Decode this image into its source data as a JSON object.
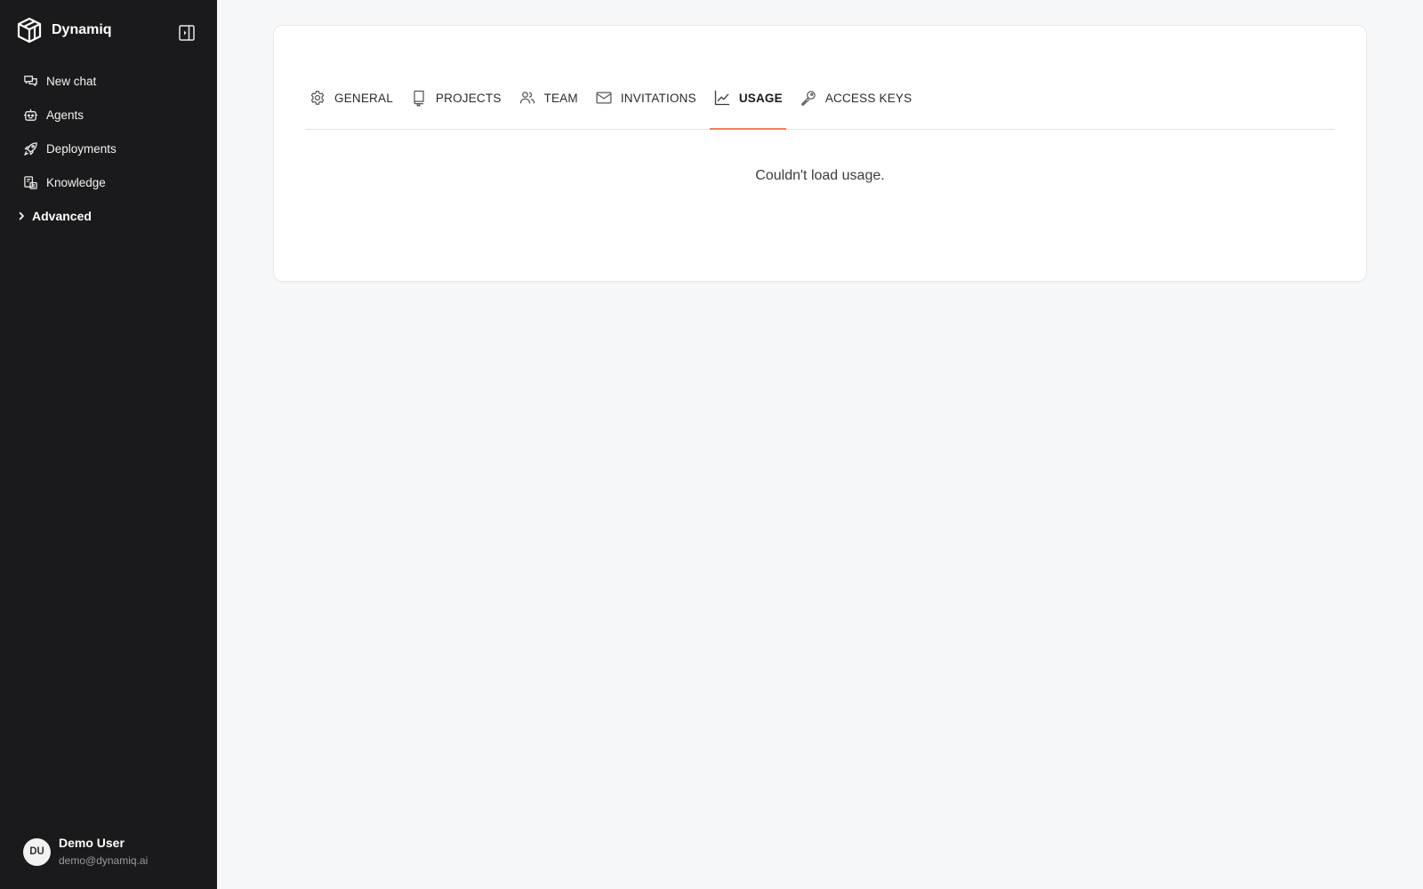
{
  "brand": {
    "name": "Dynamiq"
  },
  "sidebar": {
    "items": [
      {
        "label": "New chat",
        "icon": "chat-icon"
      },
      {
        "label": "Agents",
        "icon": "robot-icon"
      },
      {
        "label": "Deployments",
        "icon": "rocket-icon"
      },
      {
        "label": "Knowledge",
        "icon": "knowledge-icon"
      }
    ],
    "group": {
      "label": "Advanced",
      "icon": "chevron-right-icon"
    }
  },
  "user": {
    "initials": "DU",
    "name": "Demo User",
    "email": "demo@dynamiq.ai"
  },
  "settings": {
    "tabs": [
      {
        "label": "GENERAL",
        "icon": "gear-icon"
      },
      {
        "label": "PROJECTS",
        "icon": "book-icon"
      },
      {
        "label": "TEAM",
        "icon": "users-icon"
      },
      {
        "label": "INVITATIONS",
        "icon": "envelope-icon"
      },
      {
        "label": "USAGE",
        "icon": "line-chart-icon",
        "active": true
      },
      {
        "label": "ACCESS KEYS",
        "icon": "key-icon"
      }
    ],
    "message": "Couldn't load usage."
  },
  "colors": {
    "sidebar_bg": "#1a1a1c",
    "page_bg": "#f6f7f9",
    "accent": "#f47a5e"
  }
}
